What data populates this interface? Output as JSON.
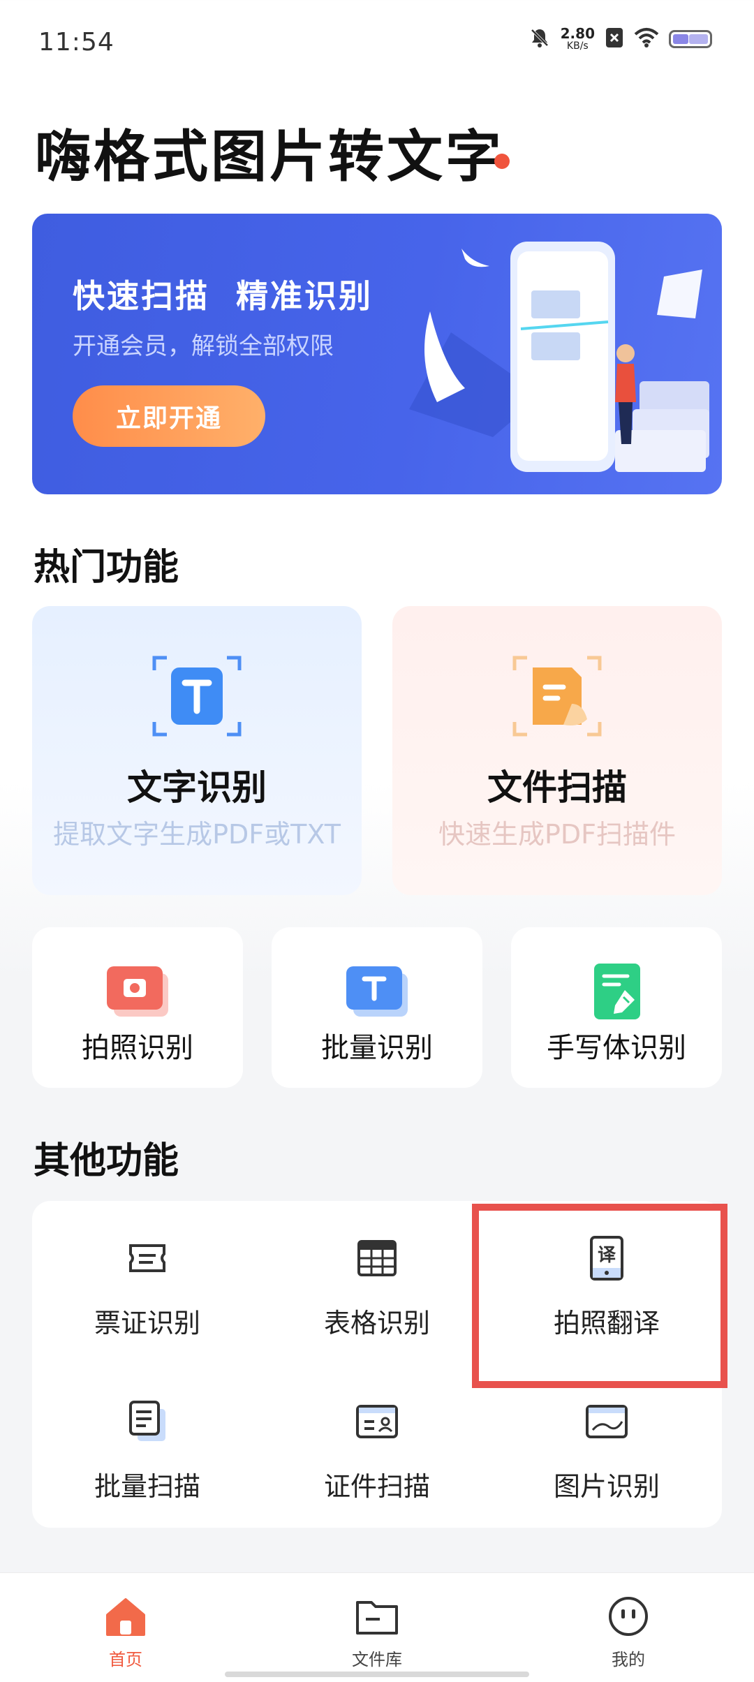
{
  "status_bar": {
    "time": "11:54",
    "net_speed": "2.80",
    "net_unit": "KB/s"
  },
  "app": {
    "title": "嗨格式图片转文字"
  },
  "banner": {
    "title": "快速扫描  精准识别",
    "subtitle": "开通会员，解锁全部权限",
    "button": "立即开通"
  },
  "hot": {
    "section_title": "热门功能",
    "cards": [
      {
        "title": "文字识别",
        "subtitle": "提取文字生成PDF或TXT",
        "icon": "text-scan-icon"
      },
      {
        "title": "文件扫描",
        "subtitle": "快速生成PDF扫描件",
        "icon": "file-scan-icon"
      }
    ],
    "small": [
      {
        "label": "拍照识别",
        "icon": "camera-icon"
      },
      {
        "label": "批量识别",
        "icon": "batch-text-icon"
      },
      {
        "label": "手写体识别",
        "icon": "handwriting-icon"
      }
    ]
  },
  "other": {
    "section_title": "其他功能",
    "items": [
      {
        "label": "票证识别",
        "icon": "ticket-icon"
      },
      {
        "label": "表格识别",
        "icon": "table-icon"
      },
      {
        "label": "拍照翻译",
        "icon": "translate-icon"
      },
      {
        "label": "批量扫描",
        "icon": "batch-doc-icon"
      },
      {
        "label": "证件扫描",
        "icon": "id-card-icon"
      },
      {
        "label": "图片识别",
        "icon": "image-icon"
      }
    ]
  },
  "nav": {
    "items": [
      {
        "label": "首页",
        "icon": "home-icon",
        "active": true
      },
      {
        "label": "文件库",
        "icon": "folder-icon",
        "active": false
      },
      {
        "label": "我的",
        "icon": "profile-icon",
        "active": false
      }
    ]
  },
  "colors": {
    "accent": "#f0543d",
    "banner": "#4764ea",
    "blue": "#4e8ff5",
    "orange": "#f5a54a",
    "green": "#2ecf85"
  }
}
